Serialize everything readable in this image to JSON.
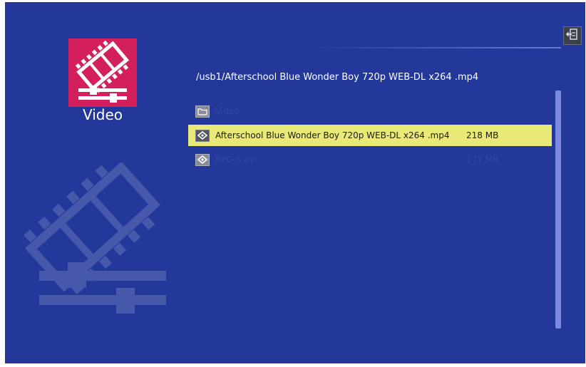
{
  "category": {
    "label": "Video",
    "icon": "video-clip-icon",
    "tile_color": "#d31f5c"
  },
  "path": "/usb1/Afterschool Blue Wonder Boy 720p WEB-DL x264 .mp4",
  "files": [
    {
      "type": "folder",
      "icon": "folder-icon",
      "name": "Video",
      "size": "",
      "selected": false
    },
    {
      "type": "video",
      "icon": "video-file-icon",
      "name": "Afterschool Blue Wonder Boy 720p WEB-DL x264 .mp4",
      "size": "218 MB",
      "selected": true
    },
    {
      "type": "video",
      "icon": "video-file-icon",
      "name": "RPG 5.avi",
      "size": "177 MB",
      "selected": false
    }
  ],
  "actions": {
    "exit_icon": "exit-icon"
  },
  "colors": {
    "background": "#24379a",
    "selection": "#e8e977",
    "accent": "#d31f5c"
  }
}
